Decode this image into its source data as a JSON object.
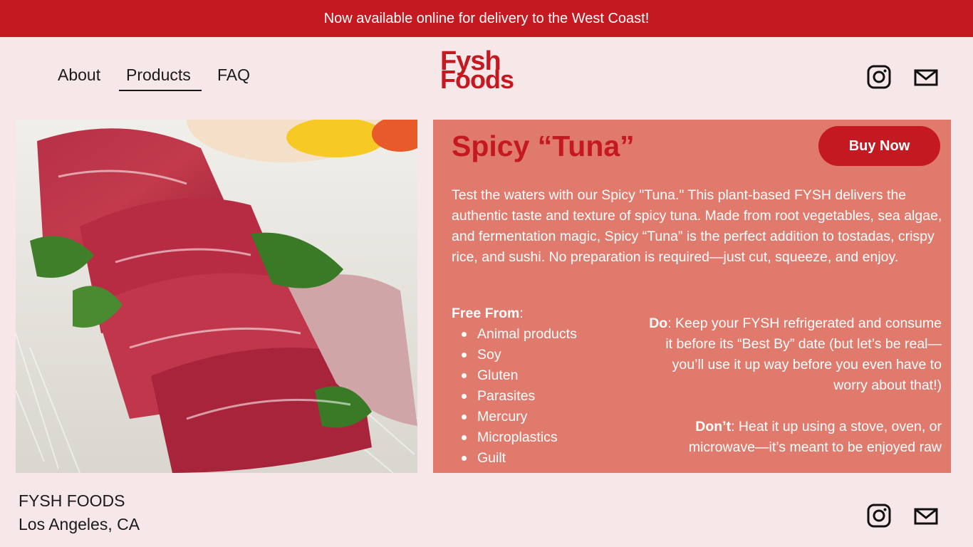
{
  "banner": {
    "text": "Now available online for delivery to the West Coast!"
  },
  "nav": {
    "links": [
      {
        "label": "About"
      },
      {
        "label": "Products",
        "active": true
      },
      {
        "label": "FAQ"
      }
    ],
    "logo": {
      "line1": "Fysh",
      "line2": "Foods"
    },
    "icons": [
      "instagram-icon",
      "mail-icon"
    ]
  },
  "product": {
    "title": "Spicy “Tuna”",
    "buy_label": "Buy Now",
    "description": "Test the waters with our Spicy \"Tuna.\" This plant-based FYSH delivers the authentic taste and texture of spicy tuna. Made from root vegetables, sea algae, and fermentation magic, Spicy “Tuna” is the perfect addition to tostadas, crispy rice, and sushi. No preparation is required—just cut, squeeze, and enjoy.",
    "free_from_label": "Free From",
    "free_from_colon": ":",
    "free_from": [
      "Animal products",
      "Soy",
      "Gluten",
      "Parasites",
      "Mercury",
      "Microplastics",
      "Guilt"
    ],
    "do_label": "Do",
    "do_text": ": Keep your FYSH refrigerated and consume it before its “Best By” date (but let’s be real—you’ll use it up way before you even have to worry about that!)",
    "dont_label": "Don’t",
    "dont_text": ": Heat it up using a stove, oven, or microwave—it’s meant to be enjoyed raw"
  },
  "footer": {
    "name": "FYSH FOODS",
    "location": "Los Angeles, CA"
  },
  "colors": {
    "brand_red": "#c41920",
    "panel": "#e07a6c",
    "background": "#f6e8e9"
  }
}
